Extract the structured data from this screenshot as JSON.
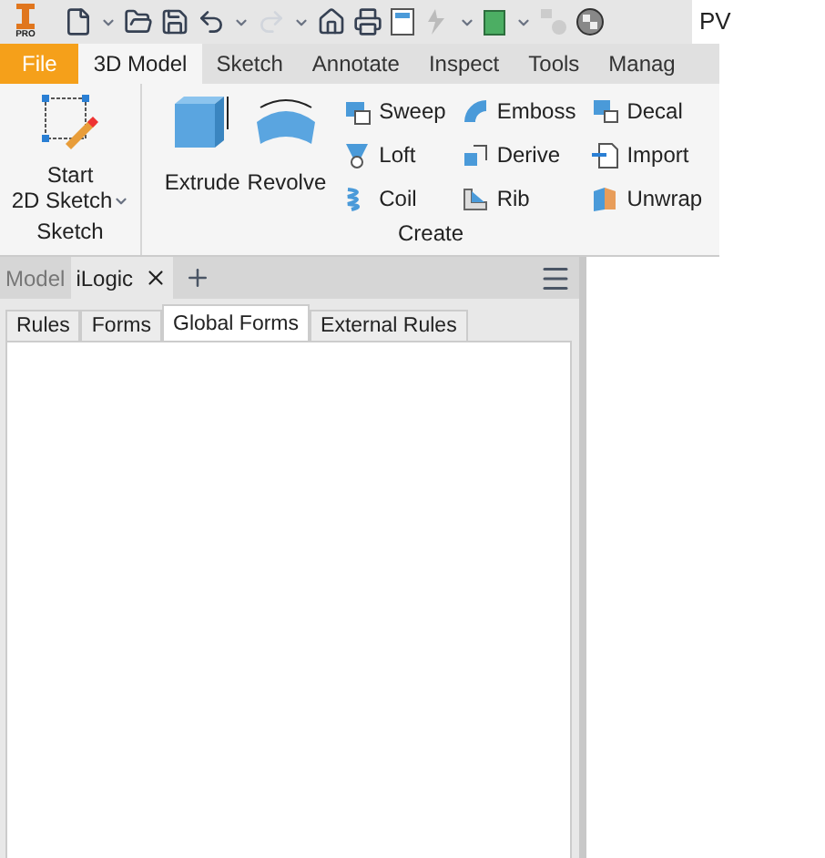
{
  "app_badge": "PRO",
  "app_title": "PV",
  "ribbon_tabs": [
    {
      "label": "File",
      "kind": "file",
      "selected": false
    },
    {
      "label": "3D Model",
      "kind": "tab",
      "selected": true
    },
    {
      "label": "Sketch",
      "kind": "tab",
      "selected": false
    },
    {
      "label": "Annotate",
      "kind": "tab",
      "selected": false
    },
    {
      "label": "Inspect",
      "kind": "tab",
      "selected": false
    },
    {
      "label": "Tools",
      "kind": "tab",
      "selected": false
    },
    {
      "label": "Manag",
      "kind": "tab",
      "selected": false
    }
  ],
  "sketch_group": {
    "title": "Sketch",
    "button": {
      "line1": "Start",
      "line2": "2D Sketch"
    }
  },
  "create_group": {
    "title": "Create",
    "large_buttons": [
      "Extrude",
      "Revolve"
    ],
    "small_columns": [
      [
        "Sweep",
        "Loft",
        "Coil"
      ],
      [
        "Emboss",
        "Derive",
        "Rib"
      ],
      [
        "Decal",
        "Import",
        "Unwrap"
      ]
    ]
  },
  "browser_tabs": [
    {
      "label": "Model",
      "selected": false
    },
    {
      "label": "iLogic",
      "selected": true
    }
  ],
  "ilogic_tabs": [
    {
      "label": "Rules",
      "selected": false
    },
    {
      "label": "Forms",
      "selected": false
    },
    {
      "label": "Global Forms",
      "selected": true
    },
    {
      "label": "External Rules",
      "selected": false
    }
  ]
}
